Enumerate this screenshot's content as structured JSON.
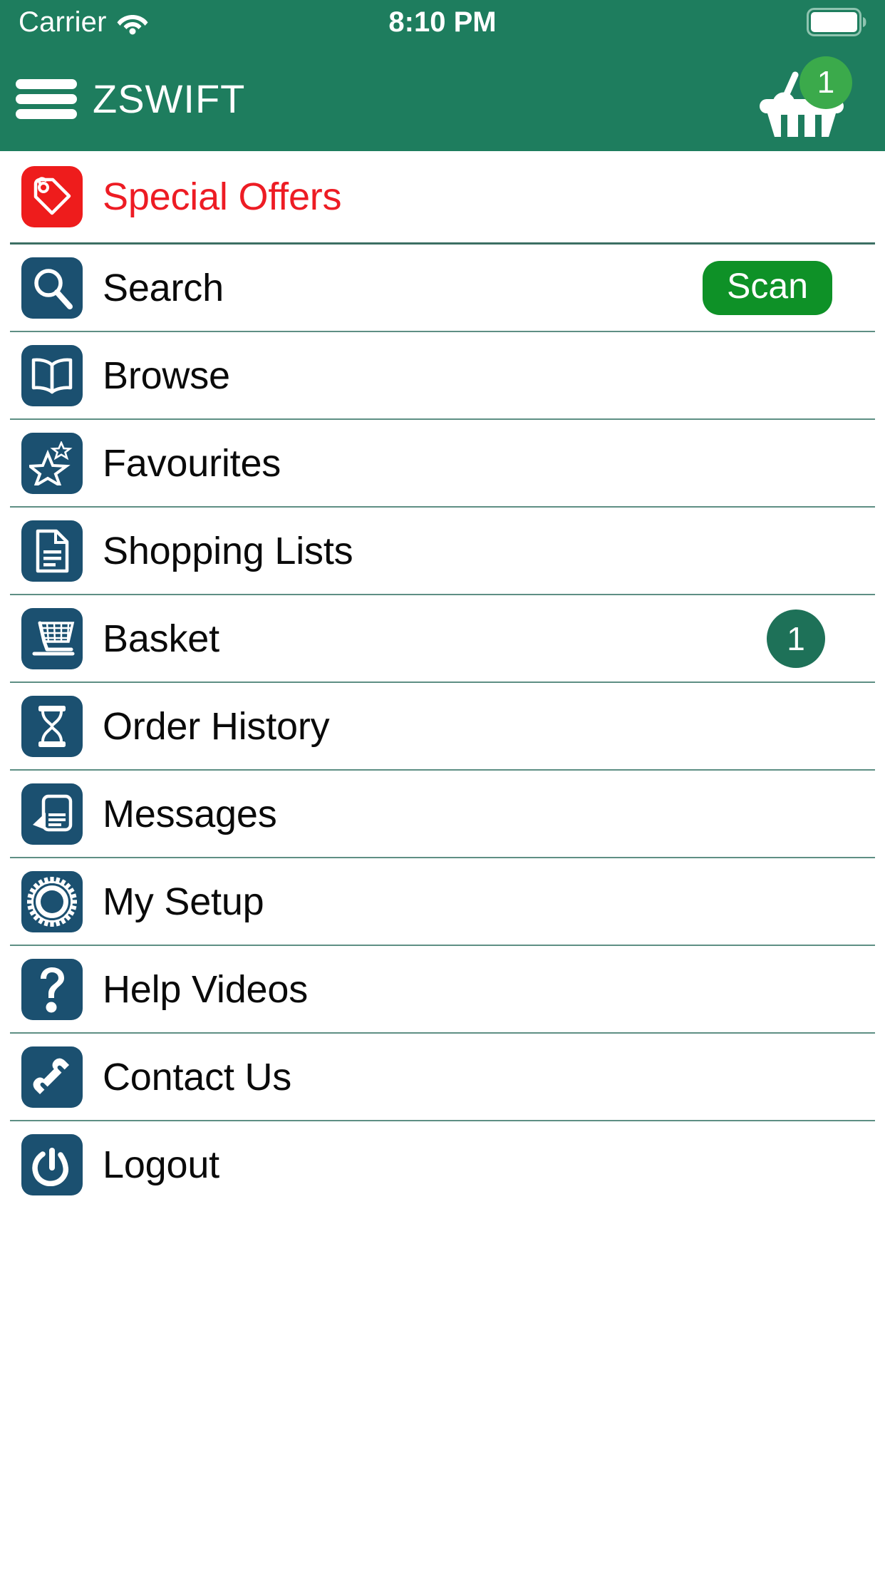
{
  "status_bar": {
    "carrier": "Carrier",
    "time": "8:10 PM",
    "wifi_icon": "wifi-icon",
    "battery_icon": "battery-full-icon"
  },
  "nav_bar": {
    "menu_icon": "hamburger-menu-icon",
    "title": "ZSWIFT",
    "basket_icon": "shopping-basket-icon",
    "basket_badge_count": "1",
    "badge_color": "#3BAA4B",
    "background_color": "#1E7D5E"
  },
  "theme": {
    "header_green": "#1E7D5E",
    "tile_navy": "#1B5070",
    "offer_red": "#EE1C1C",
    "scan_green": "#0E9127",
    "divider_green": "#3C6F63"
  },
  "menu": {
    "items": [
      {
        "id": "special-offers",
        "label": "Special Offers",
        "icon": "price-tag-icon",
        "accent": "red",
        "badge": null,
        "action": null
      },
      {
        "id": "search",
        "label": "Search",
        "icon": "magnifier-icon",
        "accent": "navy",
        "badge": null,
        "action": "Scan"
      },
      {
        "id": "browse",
        "label": "Browse",
        "icon": "open-book-icon",
        "accent": "navy",
        "badge": null,
        "action": null
      },
      {
        "id": "favourites",
        "label": "Favourites",
        "icon": "star-icon",
        "accent": "navy",
        "badge": null,
        "action": null
      },
      {
        "id": "shopping-lists",
        "label": "Shopping Lists",
        "icon": "document-list-icon",
        "accent": "navy",
        "badge": null,
        "action": null
      },
      {
        "id": "basket",
        "label": "Basket",
        "icon": "shopping-trolley-icon",
        "accent": "navy",
        "badge": "1",
        "action": null
      },
      {
        "id": "order-history",
        "label": "Order History",
        "icon": "hourglass-icon",
        "accent": "navy",
        "badge": null,
        "action": null
      },
      {
        "id": "messages",
        "label": "Messages",
        "icon": "message-document-icon",
        "accent": "navy",
        "badge": null,
        "action": null
      },
      {
        "id": "my-setup",
        "label": "My Setup",
        "icon": "gear-icon",
        "accent": "navy",
        "badge": null,
        "action": null
      },
      {
        "id": "help-videos",
        "label": "Help Videos",
        "icon": "question-mark-icon",
        "accent": "navy",
        "badge": null,
        "action": null
      },
      {
        "id": "contact-us",
        "label": "Contact Us",
        "icon": "phone-handset-icon",
        "accent": "navy",
        "badge": null,
        "action": null
      },
      {
        "id": "logout",
        "label": "Logout",
        "icon": "power-icon",
        "accent": "navy",
        "badge": null,
        "action": null
      }
    ]
  }
}
